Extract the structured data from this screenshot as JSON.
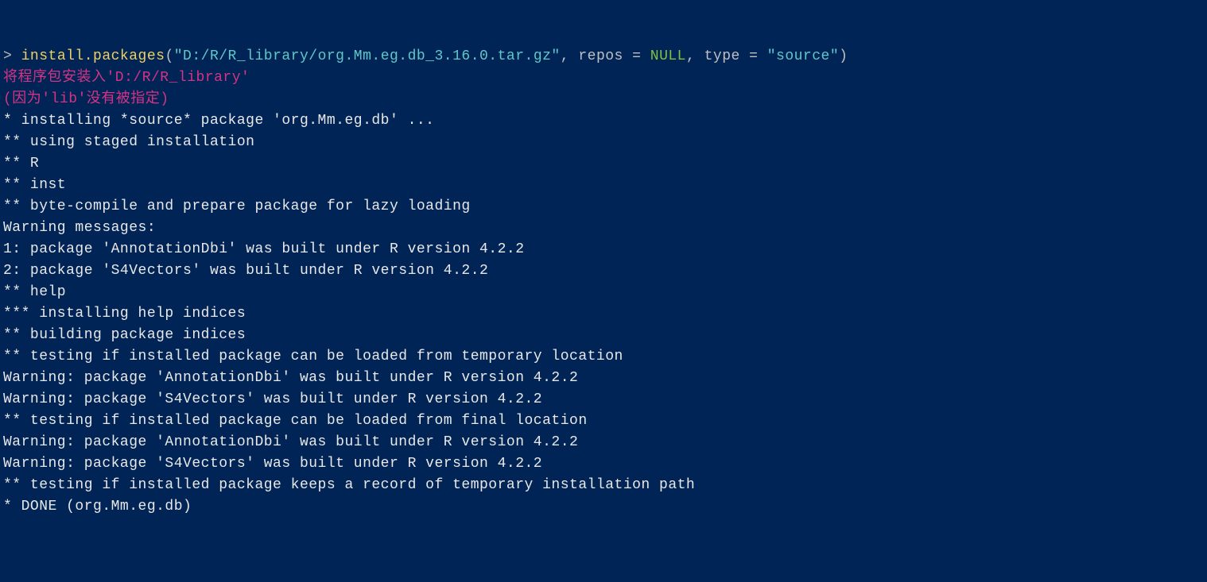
{
  "prompt": {
    "symbol": "> ",
    "command": "install.packages",
    "open_paren": "(",
    "arg1_string": "\"D:/R/R_library/org.Mm.eg.db_3.16.0.tar.gz\"",
    "sep1": ", ",
    "param1_name": "repos",
    "eq1": " = ",
    "param1_value": "NULL",
    "sep2": ", ",
    "param2_name": "type",
    "eq2": " = ",
    "param2_value": "\"source\"",
    "close_paren": ")"
  },
  "install_msg": {
    "line1": "将程序包安装入'D:/R/R_library'",
    "line2": "(因为'lib'没有被指定)"
  },
  "output_lines": [
    "* installing *source* package 'org.Mm.eg.db' ...",
    "** using staged installation",
    "** R",
    "** inst",
    "** byte-compile and prepare package for lazy loading",
    "Warning messages:",
    "1: package 'AnnotationDbi' was built under R version 4.2.2",
    "2: package 'S4Vectors' was built under R version 4.2.2",
    "** help",
    "*** installing help indices",
    "** building package indices",
    "** testing if installed package can be loaded from temporary location",
    "Warning: package 'AnnotationDbi' was built under R version 4.2.2",
    "Warning: package 'S4Vectors' was built under R version 4.2.2",
    "** testing if installed package can be loaded from final location",
    "Warning: package 'AnnotationDbi' was built under R version 4.2.2",
    "Warning: package 'S4Vectors' was built under R version 4.2.2",
    "** testing if installed package keeps a record of temporary installation path",
    "* DONE (org.Mm.eg.db)"
  ]
}
